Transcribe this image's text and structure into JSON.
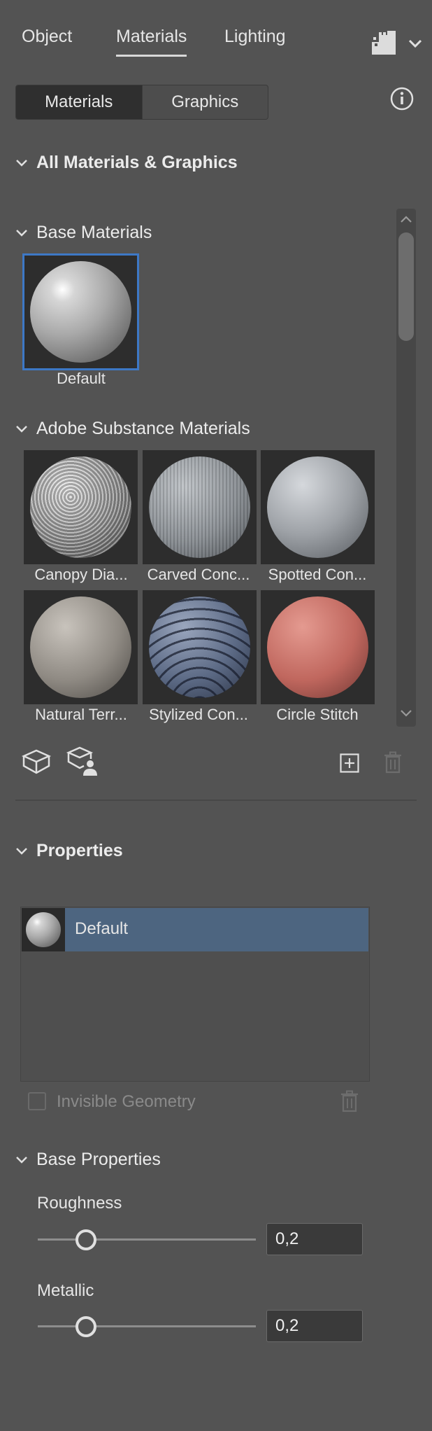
{
  "top_tabs": [
    {
      "label": "Object"
    },
    {
      "label": "Materials"
    },
    {
      "label": "Lighting"
    }
  ],
  "segmented": {
    "materials": "Materials",
    "graphics": "Graphics"
  },
  "sections": {
    "all": "All Materials & Graphics",
    "base": "Base Materials",
    "substance": "Adobe Substance Materials",
    "properties": "Properties",
    "base_properties": "Base Properties"
  },
  "base_materials": [
    {
      "label": "Default"
    }
  ],
  "substance_materials": [
    {
      "label": "Canopy Dia..."
    },
    {
      "label": "Carved Conc..."
    },
    {
      "label": "Spotted Con..."
    },
    {
      "label": "Natural Terr..."
    },
    {
      "label": "Stylized Con..."
    },
    {
      "label": "Circle Stitch"
    }
  ],
  "properties": {
    "selected_material": "Default",
    "invisible_geometry_label": "Invisible Geometry",
    "invisible_geometry_checked": false
  },
  "base_properties": {
    "roughness_label": "Roughness",
    "roughness_value": "0,2",
    "metallic_label": "Metallic",
    "metallic_value": "0,2"
  },
  "colors": {
    "panel_bg": "#535353",
    "selection": "#3d78c6",
    "row_highlight": "#4d6580"
  },
  "icons": [
    "info-icon",
    "panel-menu-icon",
    "chevron-down-icon",
    "cube-icon",
    "cube-user-icon",
    "add-icon",
    "trash-icon",
    "scroll-up-icon",
    "scroll-down-icon"
  ]
}
